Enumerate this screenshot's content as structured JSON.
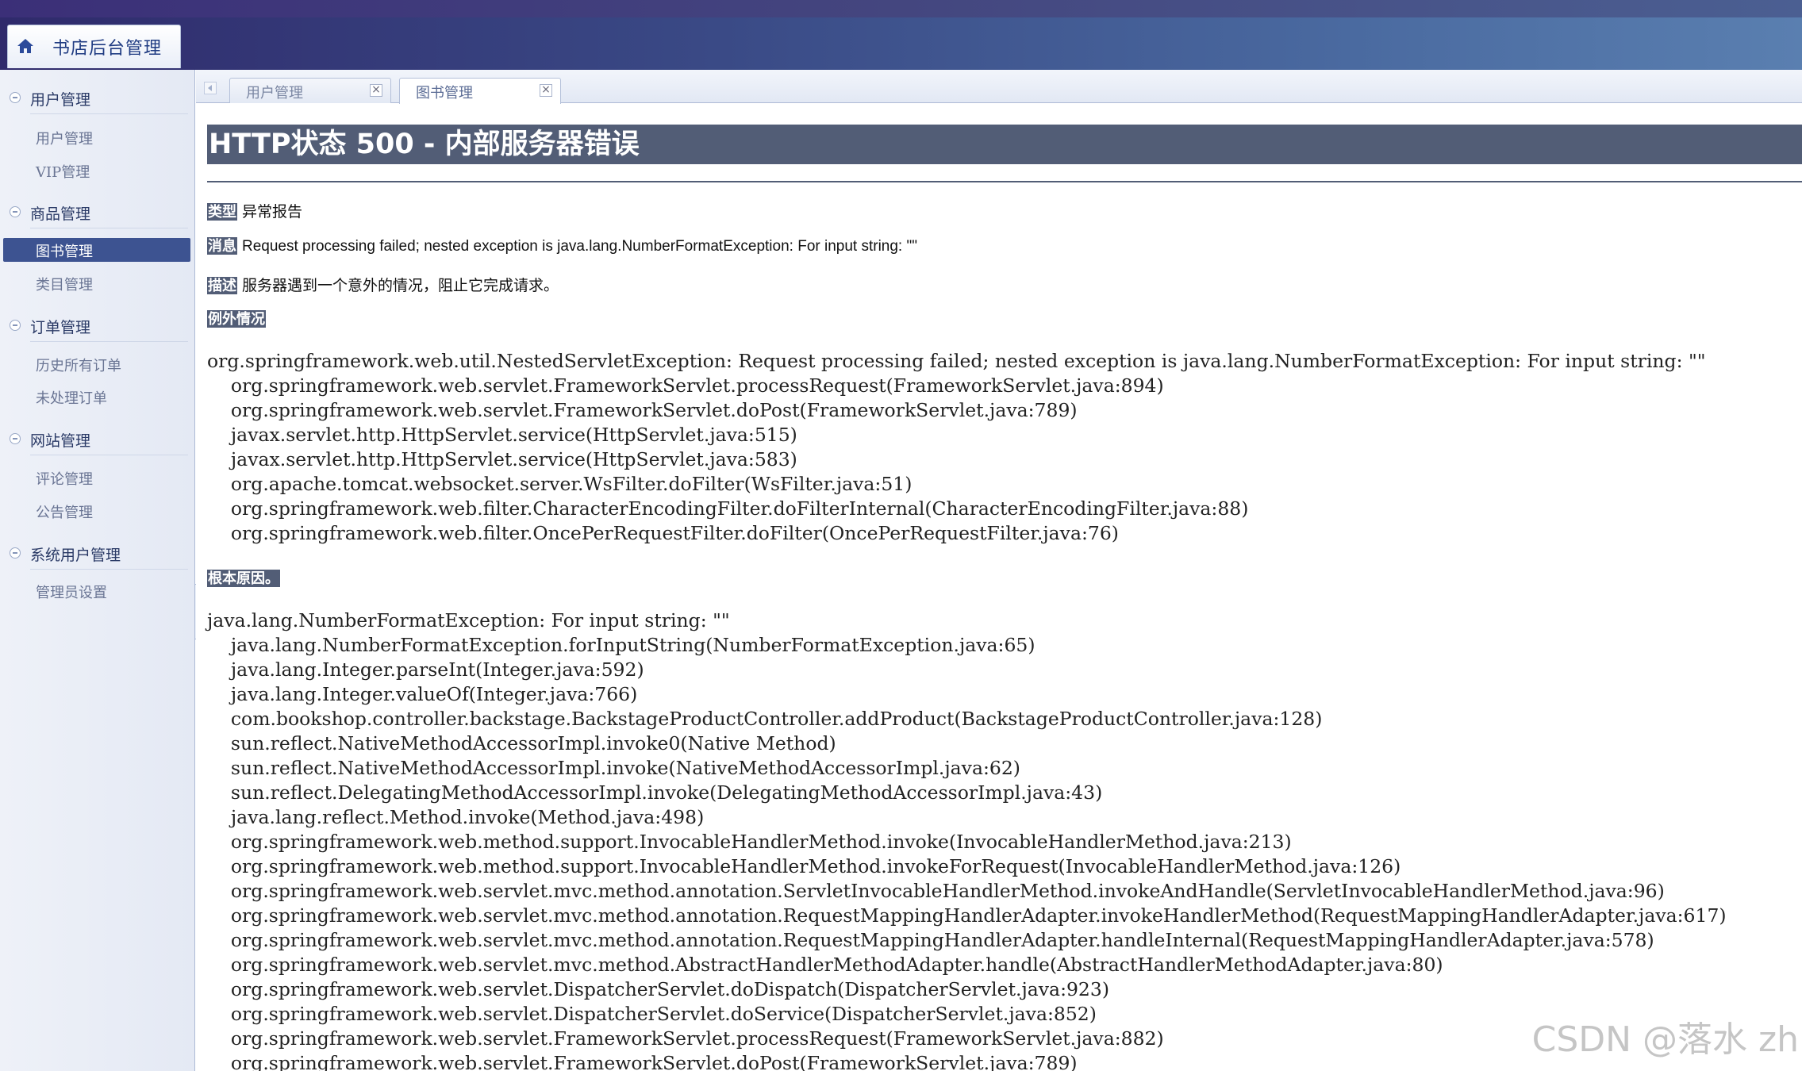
{
  "app": {
    "title": "书店后台管理"
  },
  "sidebar": {
    "groups": [
      {
        "label": "用户管理",
        "items": [
          {
            "label": "用户管理"
          },
          {
            "label": "VIP管理"
          }
        ]
      },
      {
        "label": "商品管理",
        "items": [
          {
            "label": "图书管理",
            "active": true
          },
          {
            "label": "类目管理"
          }
        ]
      },
      {
        "label": "订单管理",
        "items": [
          {
            "label": "历史所有订单"
          },
          {
            "label": "未处理订单"
          }
        ]
      },
      {
        "label": "网站管理",
        "items": [
          {
            "label": "评论管理"
          },
          {
            "label": "公告管理"
          }
        ]
      },
      {
        "label": "系统用户管理",
        "items": [
          {
            "label": "管理员设置"
          }
        ]
      }
    ]
  },
  "tabs": [
    {
      "label": "用户管理",
      "active": false
    },
    {
      "label": "图书管理",
      "active": true
    }
  ],
  "tab_close_glyph": "×",
  "error": {
    "title": "HTTP状态 500 - 内部服务器错误",
    "type_label": "类型",
    "type_value": "异常报告",
    "message_label": "消息",
    "message_value": "Request processing failed; nested exception is java.lang.NumberFormatException: For input string: \"\"",
    "description_label": "描述",
    "description_value": "服务器遇到一个意外的情况，阻止它完成请求。",
    "exception_label": "例外情况",
    "exception_trace": "org.springframework.web.util.NestedServletException: Request processing failed; nested exception is java.lang.NumberFormatException: For input string: \"\"\n\torg.springframework.web.servlet.FrameworkServlet.processRequest(FrameworkServlet.java:894)\n\torg.springframework.web.servlet.FrameworkServlet.doPost(FrameworkServlet.java:789)\n\tjavax.servlet.http.HttpServlet.service(HttpServlet.java:515)\n\tjavax.servlet.http.HttpServlet.service(HttpServlet.java:583)\n\torg.apache.tomcat.websocket.server.WsFilter.doFilter(WsFilter.java:51)\n\torg.springframework.web.filter.CharacterEncodingFilter.doFilterInternal(CharacterEncodingFilter.java:88)\n\torg.springframework.web.filter.OncePerRequestFilter.doFilter(OncePerRequestFilter.java:76)",
    "root_cause_label": "根本原因。",
    "root_cause_trace": "java.lang.NumberFormatException: For input string: \"\"\n\tjava.lang.NumberFormatException.forInputString(NumberFormatException.java:65)\n\tjava.lang.Integer.parseInt(Integer.java:592)\n\tjava.lang.Integer.valueOf(Integer.java:766)\n\tcom.bookshop.controller.backstage.BackstageProductController.addProduct(BackstageProductController.java:128)\n\tsun.reflect.NativeMethodAccessorImpl.invoke0(Native Method)\n\tsun.reflect.NativeMethodAccessorImpl.invoke(NativeMethodAccessorImpl.java:62)\n\tsun.reflect.DelegatingMethodAccessorImpl.invoke(DelegatingMethodAccessorImpl.java:43)\n\tjava.lang.reflect.Method.invoke(Method.java:498)\n\torg.springframework.web.method.support.InvocableHandlerMethod.invoke(InvocableHandlerMethod.java:213)\n\torg.springframework.web.method.support.InvocableHandlerMethod.invokeForRequest(InvocableHandlerMethod.java:126)\n\torg.springframework.web.servlet.mvc.method.annotation.ServletInvocableHandlerMethod.invokeAndHandle(ServletInvocableHandlerMethod.java:96)\n\torg.springframework.web.servlet.mvc.method.annotation.RequestMappingHandlerAdapter.invokeHandlerMethod(RequestMappingHandlerAdapter.java:617)\n\torg.springframework.web.servlet.mvc.method.annotation.RequestMappingHandlerAdapter.handleInternal(RequestMappingHandlerAdapter.java:578)\n\torg.springframework.web.servlet.mvc.method.AbstractHandlerMethodAdapter.handle(AbstractHandlerMethodAdapter.java:80)\n\torg.springframework.web.servlet.DispatcherServlet.doDispatch(DispatcherServlet.java:923)\n\torg.springframework.web.servlet.DispatcherServlet.doService(DispatcherServlet.java:852)\n\torg.springframework.web.servlet.FrameworkServlet.processRequest(FrameworkServlet.java:882)\n\torg.springframework.web.servlet.FrameworkServlet.doPost(FrameworkServlet.java:789)"
  },
  "watermark": "CSDN @落水 zh",
  "colors": {
    "header_dark": "#2f2a6b",
    "error_title_bg": "#525d76",
    "active_item_bg": "#3d5391"
  }
}
